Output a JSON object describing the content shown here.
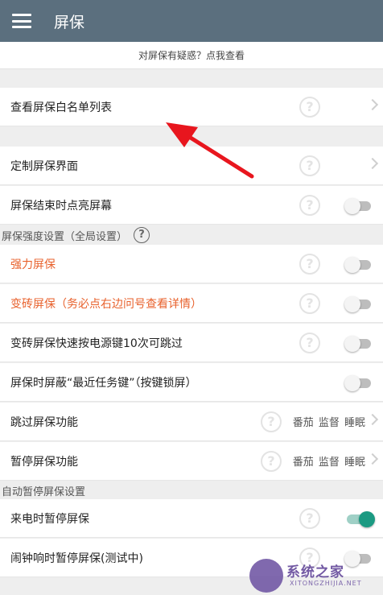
{
  "app_bar": {
    "title": "屏保",
    "menu_icon": "hamburger-menu-icon"
  },
  "notice": {
    "text": "对屏保有疑惑？点我查看"
  },
  "whitelist_row": {
    "label": "查看屏保白名单列表"
  },
  "customize_row": {
    "label": "定制屏保界面"
  },
  "light_screen_row": {
    "label": "屏保结束时点亮屏幕",
    "enabled": false
  },
  "strength_section": {
    "title": "屏保强度设置（全局设置）"
  },
  "strong_row": {
    "label": "强力屏保",
    "enabled": false
  },
  "brick_row": {
    "label": "变砖屏保（务必点右边问号查看详情）",
    "enabled": false
  },
  "brick_skip_row": {
    "label": "变砖屏保快速按电源键10次可跳过",
    "enabled": false
  },
  "block_recent_row": {
    "label": "屏保时屏蔽“最近任务键”（按键锁屏）",
    "enabled": false
  },
  "skip_row": {
    "label": "跳过屏保功能",
    "value": "番茄 监督 睡眠"
  },
  "pause_row": {
    "label": "暂停屏保功能",
    "value": "番茄 监督 睡眠"
  },
  "auto_pause_section": {
    "title": "自动暂停屏保设置"
  },
  "call_pause_row": {
    "label": "来电时暂停屏保",
    "enabled": true
  },
  "alarm_pause_row": {
    "label": "闹钟响时暂停屏保(测试中)",
    "enabled": false
  },
  "help_glyph": "?",
  "colors": {
    "app_bar": "#5b6f7e",
    "warning_text": "#e8612c",
    "toggle_on": "#1b9a82",
    "arrow": "#e8161e"
  },
  "watermark": {
    "text": "系统之家",
    "sub": "XITONGZHIJIA.NET"
  }
}
